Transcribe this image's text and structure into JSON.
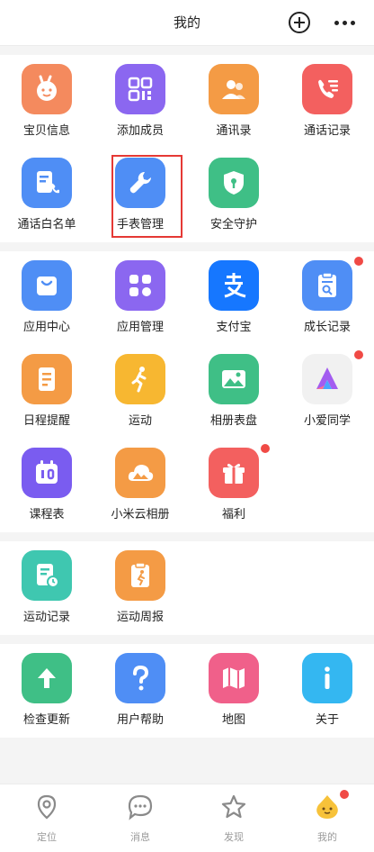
{
  "header": {
    "title": "我的"
  },
  "groups": [
    {
      "items": [
        {
          "label": "宝贝信息",
          "icon": "baby-face-icon",
          "color": "#f48a5e"
        },
        {
          "label": "添加成员",
          "icon": "qr-code-icon",
          "color": "#8b67f0"
        },
        {
          "label": "通讯录",
          "icon": "contacts-icon",
          "color": "#f49b45"
        },
        {
          "label": "通话记录",
          "icon": "phone-list-icon",
          "color": "#f3605f"
        },
        {
          "label": "通话白名单",
          "icon": "phone-whitelist-icon",
          "color": "#4f8ef5"
        },
        {
          "label": "手表管理",
          "icon": "wrench-icon",
          "color": "#4f8ef5",
          "highlighted": true
        },
        {
          "label": "安全守护",
          "icon": "shield-icon",
          "color": "#3fbf86"
        }
      ]
    },
    {
      "items": [
        {
          "label": "应用中心",
          "icon": "bag-icon",
          "color": "#4f8ef5"
        },
        {
          "label": "应用管理",
          "icon": "apps-grid-icon",
          "color": "#8b67f0"
        },
        {
          "label": "支付宝",
          "icon": "alipay-icon",
          "color": "#1677ff"
        },
        {
          "label": "成长记录",
          "icon": "clipboard-search-icon",
          "color": "#4f8ef5",
          "badge": true
        },
        {
          "label": "日程提醒",
          "icon": "note-icon",
          "color": "#f49b45"
        },
        {
          "label": "运动",
          "icon": "runner-icon",
          "color": "#f7b731"
        },
        {
          "label": "相册表盘",
          "icon": "picture-icon",
          "color": "#3fbf86"
        },
        {
          "label": "小爱同学",
          "icon": "xiaoai-icon",
          "color": "#f1f1f1",
          "badge": true
        },
        {
          "label": "课程表",
          "icon": "timetable-icon",
          "color": "#7a5cf0"
        },
        {
          "label": "小米云相册",
          "icon": "cloud-album-icon",
          "color": "#f49b45"
        },
        {
          "label": "福利",
          "icon": "gift-icon",
          "color": "#f3605f",
          "badge": true
        }
      ]
    },
    {
      "items": [
        {
          "label": "运动记录",
          "icon": "sport-record-icon",
          "color": "#3fc7b0"
        },
        {
          "label": "运动周报",
          "icon": "weekly-report-icon",
          "color": "#f49b45"
        }
      ]
    },
    {
      "items": [
        {
          "label": "检查更新",
          "icon": "arrow-up-icon",
          "color": "#3fbf86"
        },
        {
          "label": "用户帮助",
          "icon": "question-icon",
          "color": "#4f8ef5"
        },
        {
          "label": "地图",
          "icon": "map-icon",
          "color": "#f0608a"
        },
        {
          "label": "关于",
          "icon": "info-icon",
          "color": "#34b7f1"
        }
      ]
    }
  ],
  "tabbar": [
    {
      "label": "定位",
      "icon": "location-pin-icon"
    },
    {
      "label": "消息",
      "icon": "chat-bubble-icon"
    },
    {
      "label": "发现",
      "icon": "star-icon"
    },
    {
      "label": "我的",
      "icon": "mascot-icon",
      "badge": true
    }
  ]
}
